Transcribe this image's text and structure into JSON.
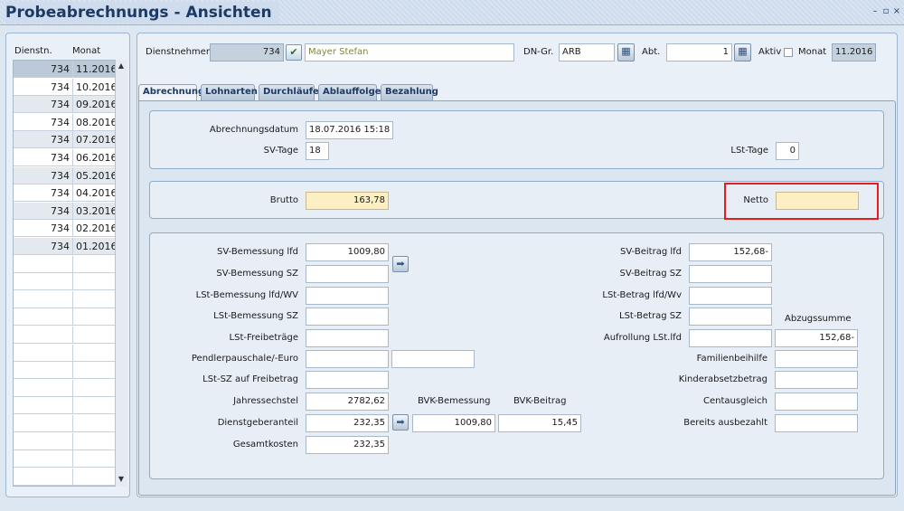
{
  "window": {
    "title": "Probeabrechnungs - Ansichten",
    "controls": [
      "minimize",
      "maximize",
      "close"
    ]
  },
  "list": {
    "headers": [
      "Dienstn.",
      "Monat"
    ],
    "rows": [
      {
        "dn": "734",
        "monat": "11.2016"
      },
      {
        "dn": "734",
        "monat": "10.2016"
      },
      {
        "dn": "734",
        "monat": "09.2016"
      },
      {
        "dn": "734",
        "monat": "08.2016"
      },
      {
        "dn": "734",
        "monat": "07.2016"
      },
      {
        "dn": "734",
        "monat": "06.2016"
      },
      {
        "dn": "734",
        "monat": "05.2016"
      },
      {
        "dn": "734",
        "monat": "04.2016"
      },
      {
        "dn": "734",
        "monat": "03.2016"
      },
      {
        "dn": "734",
        "monat": "02.2016"
      },
      {
        "dn": "734",
        "monat": "01.2016"
      }
    ]
  },
  "header": {
    "dn_label": "Dienstnehmer",
    "dn_number": "734",
    "dn_name": "Mayer Stefan",
    "dngr_label": "DN-Gr.",
    "dngr_value": "ARB",
    "abt_label": "Abt.",
    "abt_value": "1",
    "aktiv_label": "Aktiv",
    "monat_label": "Monat",
    "monat_value": "11.2016"
  },
  "tabs": [
    {
      "label": "Abrechnung",
      "active": true
    },
    {
      "label": "Lohnarten",
      "active": false
    },
    {
      "label": "Durchläufer",
      "active": false
    },
    {
      "label": "Ablauffolge",
      "active": false
    },
    {
      "label": "Bezahlung",
      "active": false
    }
  ],
  "top_group": {
    "abrechnungsdatum_label": "Abrechnungsdatum",
    "abrechnungsdatum": "18.07.2016 15:18",
    "svtage_label": "SV-Tage",
    "svtage": "18",
    "lsttage_label": "LSt-Tage",
    "lsttage": "0"
  },
  "brutto_group": {
    "brutto_label": "Brutto",
    "brutto": "163,78",
    "netto_label": "Netto",
    "netto": ""
  },
  "details": {
    "left": [
      {
        "label": "SV-Bemessung lfd",
        "value": "1009,80"
      },
      {
        "label": "SV-Bemessung SZ",
        "value": ""
      },
      {
        "label": "LSt-Bemessung lfd/WV",
        "value": ""
      },
      {
        "label": "LSt-Bemessung SZ",
        "value": ""
      },
      {
        "label": "LSt-Freibeträge",
        "value": ""
      },
      {
        "label": "Pendlerpauschale/-Euro",
        "value": "",
        "value2": ""
      },
      {
        "label": "LSt-SZ auf Freibetrag",
        "value": ""
      },
      {
        "label": "Jahressechstel",
        "value": "2782,62"
      },
      {
        "label": "Dienstgeberanteil",
        "value": "232,35"
      },
      {
        "label": "Gesamtkosten",
        "value": "232,35"
      }
    ],
    "bvk_bemessung_label": "BVK-Bemessung",
    "bvk_bemessung": "1009,80",
    "bvk_beitrag_label": "BVK-Beitrag",
    "bvk_beitrag": "15,45",
    "right": [
      {
        "label": "SV-Beitrag lfd",
        "value": "152,68-"
      },
      {
        "label": "SV-Beitrag SZ",
        "value": ""
      },
      {
        "label": "LSt-Betrag lfd/Wv",
        "value": ""
      },
      {
        "label": "LSt-Betrag SZ",
        "value": ""
      },
      {
        "label": "Aufrollung LSt.lfd",
        "value": ""
      }
    ],
    "abzugssumme_label": "Abzugssumme",
    "abzugssumme": "152,68-",
    "right2": [
      {
        "label": "Familienbeihilfe",
        "value": ""
      },
      {
        "label": "Kinderabsetzbetrag",
        "value": ""
      },
      {
        "label": "Centausgleich",
        "value": ""
      },
      {
        "label": "Bereits ausbezahlt",
        "value": ""
      }
    ]
  }
}
